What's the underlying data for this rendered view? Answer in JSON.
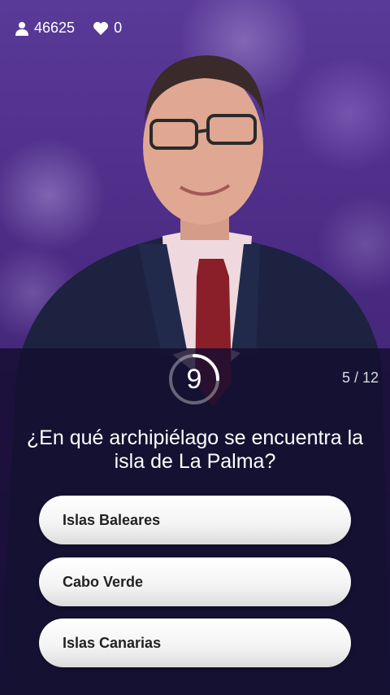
{
  "header": {
    "viewers_count": "46625",
    "likes_count": "0"
  },
  "quiz": {
    "timer": "9",
    "timer_remaining_fraction": 0.25,
    "progress": "5 / 12",
    "question": "¿En qué archipiélago se encuentra la isla de La Palma?",
    "answers": [
      {
        "label": "Islas Baleares"
      },
      {
        "label": "Cabo Verde"
      },
      {
        "label": "Islas Canarias"
      }
    ]
  },
  "colors": {
    "background": "#4a2a82",
    "panel": "#140e30",
    "text": "#ffffff"
  }
}
